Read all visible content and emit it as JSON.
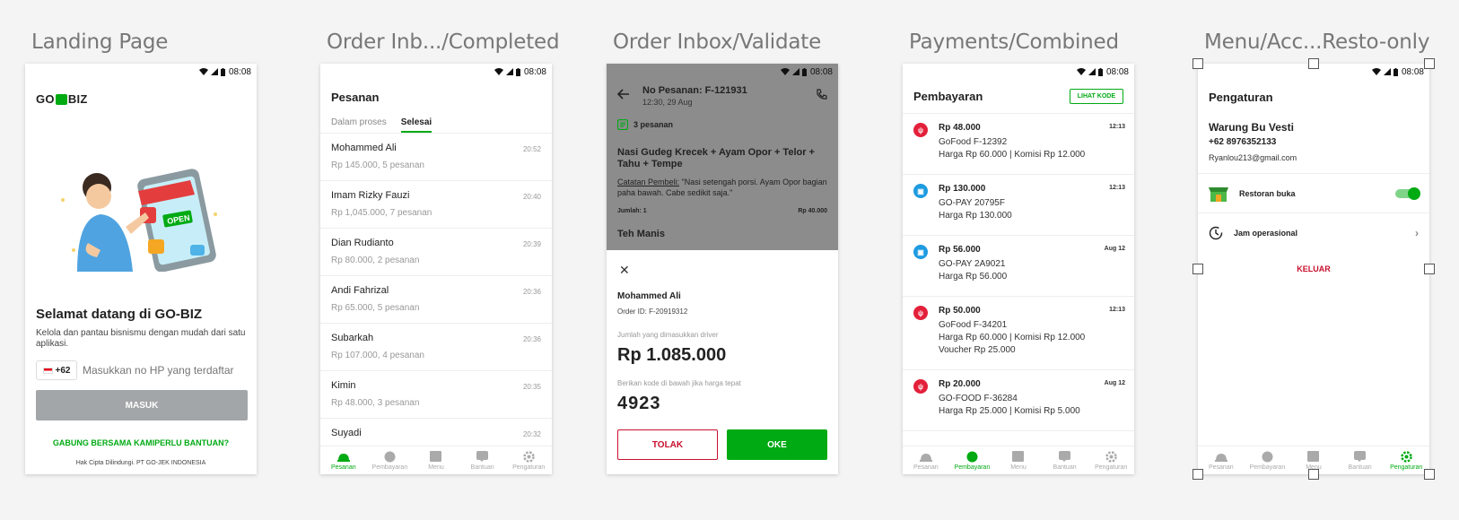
{
  "status_time": "08:08",
  "icons": {
    "wifi": "wifi-icon",
    "signal": "signal-icon",
    "battery": "battery-icon"
  },
  "colors": {
    "brand": "#00aa13",
    "danger": "#c8102e",
    "disabled": "#a3a6a8"
  },
  "nav": [
    "Pesanan",
    "Pembayaran",
    "Menu",
    "Bantuan",
    "Pengaturan"
  ],
  "landing": {
    "artboard_title": "Landing Page",
    "logo_left": "GO",
    "logo_right": "BIZ",
    "welcome": "Selamat datang di GO-BIZ",
    "subtitle": "Kelola dan pantau bisnismu dengan mudah dari satu aplikasi.",
    "country_code": "+62",
    "phone_placeholder": "Masukkan no HP yang terdaftar",
    "login_label": "MASUK",
    "join_label": "GABUNG BERSAMA KAMI",
    "help_label": "PERLU BANTUAN?",
    "copyright": "Hak Cipta Dilindungi. PT GO-JEK INDONESIA",
    "illus_sign": "OPEN"
  },
  "inbox": {
    "artboard_title": "Order Inb.../Completed",
    "title": "Pesanan",
    "tabs": [
      "Dalam proses",
      "Selesai"
    ],
    "orders": [
      {
        "name": "Mohammed Ali",
        "detail": "Rp 145.000, 5 pesanan",
        "time": "20:52"
      },
      {
        "name": "Imam Rizky Fauzi",
        "detail": "Rp 1,045.000, 7 pesanan",
        "time": "20:40"
      },
      {
        "name": "Dian Rudianto",
        "detail": "Rp 80.000, 2 pesanan",
        "time": "20:39"
      },
      {
        "name": "Andi Fahrizal",
        "detail": "Rp 65.000, 5 pesanan",
        "time": "20:36"
      },
      {
        "name": "Subarkah",
        "detail": "Rp 107.000, 4 pesanan",
        "time": "20:36"
      },
      {
        "name": "Kimin",
        "detail": "Rp 48.000, 3 pesanan",
        "time": "20:35"
      },
      {
        "name": "Suyadi",
        "detail": "",
        "time": "20:32"
      }
    ]
  },
  "validate": {
    "artboard_title": "Order Inbox/Validate",
    "order_no": "No Pesanan: F-121931",
    "order_date": "12:30, 29 Aug",
    "count": "3 pesanan",
    "item1": "Nasi Gudeg Krecek + Ayam Opor + Telor + Tahu + Tempe",
    "note_label": "Catatan Pembeli:",
    "note_text": " \"Nasi setengah porsi. Ayam Opor bagian paha bawah. Cabe sedikit saja.\"",
    "qty": "Jumlah: 1",
    "item1_price": "Rp 40.000",
    "item2": "Teh Manis",
    "customer": "Mohammed Ali",
    "order_id": "Order ID: F-20919312",
    "driver_label": "Jumlah yang dimasukkan driver",
    "amount": "Rp 1.085.000",
    "code_label": "Berikan kode di bawah jika harga tepat",
    "code": "4923",
    "reject_label": "TOLAK",
    "ok_label": "OKE"
  },
  "payments": {
    "artboard_title": "Payments/Combined",
    "title": "Pembayaran",
    "code_button": "LIHAT KODE",
    "items": [
      {
        "kind": "gofood",
        "amount": "Rp 48.000",
        "time": "12:13",
        "lines": [
          "GoFood F-12392",
          "Harga Rp 60.000 | Komisi Rp 12.000"
        ]
      },
      {
        "kind": "gopay",
        "amount": "Rp 130.000",
        "time": "12:13",
        "lines": [
          "GO-PAY 20795F",
          "Harga Rp 130.000"
        ]
      },
      {
        "kind": "gopay",
        "amount": "Rp 56.000",
        "time": "Aug 12",
        "lines": [
          "GO-PAY 2A9021",
          "Harga Rp 56.000"
        ]
      },
      {
        "kind": "gofood",
        "amount": "Rp 50.000",
        "time": "12:13",
        "lines": [
          "GoFood F-34201",
          "Harga Rp 60.000 | Komisi Rp 12.000",
          "Voucher Rp 25.000"
        ]
      },
      {
        "kind": "gofood",
        "amount": "Rp 20.000",
        "time": "Aug 12",
        "lines": [
          "GO-FOOD F-36284",
          "Harga Rp 25.000 | Komisi Rp 5.000"
        ]
      }
    ]
  },
  "settings": {
    "artboard_title": "Menu/Acc...Resto-only",
    "title": "Pengaturan",
    "store_name": "Warung Bu Vesti",
    "phone": "+62 8976352133",
    "email": "Ryanlou213@gmail.com",
    "resto_open": "Restoran buka",
    "hours": "Jam operasional",
    "logout": "KELUAR"
  }
}
